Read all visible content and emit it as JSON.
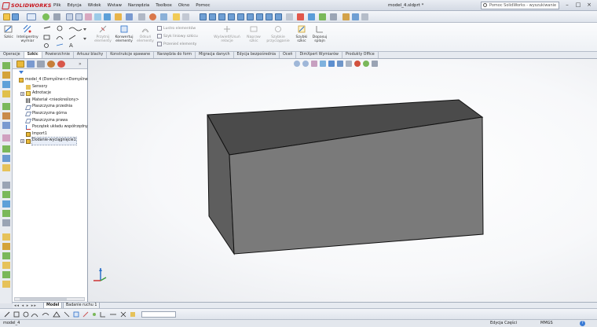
{
  "app": {
    "brand": "SOLIDWORKS",
    "document_title": "model_4.sldprt *",
    "search_placeholder": "Pomoc SolidWorks - wyszukiwanie",
    "menu": [
      "Plik",
      "Edycja",
      "Widok",
      "Wstaw",
      "Narzędzia",
      "Toolbox",
      "Okno",
      "Pomoc"
    ],
    "window_controls": [
      "–",
      "□",
      "×"
    ]
  },
  "ribbon": {
    "sketch": "Szkic",
    "smart_dimension": [
      "Inteligentny",
      "wymiar"
    ],
    "convert": [
      "Przytnij",
      "elementy"
    ],
    "convert_entities": [
      "Konwertuj",
      "elementy"
    ],
    "offset": [
      "Odsuń",
      "elementy"
    ],
    "mirror": "Lustro elementów",
    "linear_pattern": "Szyk liniowy szkicu",
    "move": "Przenieś elementy",
    "display_relations": [
      "Wyświetl/Usuń",
      "relacje"
    ],
    "repair_sketch": [
      "Napraw",
      "szkic"
    ],
    "quick_snaps": [
      "Szybkie",
      "przyciąganie"
    ],
    "rapid_sketch": [
      "Szybki",
      "szkic"
    ],
    "fit_spline": [
      "Dopasuj",
      "splajn"
    ]
  },
  "tabs": [
    "Operacje",
    "Szkic",
    "Powierzchnie",
    "Arkusz blachy",
    "Konstrukcje spawane",
    "Narzędzia do form",
    "Migracja danych",
    "Edycja bezpośrednia",
    "Oceń",
    "DimXpert Wymiarów",
    "Produkty Office"
  ],
  "active_tab": "Szkic",
  "tree": {
    "root": "model_4  (Domyślne<<Domyślne",
    "items": [
      {
        "label": "Sensory",
        "icon": "sensors-icon",
        "expandable": false
      },
      {
        "label": "Adnotacje",
        "icon": "annotations-icon",
        "expandable": true
      },
      {
        "label": "Materiał <nieokreślony>",
        "icon": "material-icon",
        "expandable": false
      },
      {
        "label": "Płaszczyzna przednia",
        "icon": "plane-icon",
        "expandable": false
      },
      {
        "label": "Płaszczyzna górna",
        "icon": "plane-icon",
        "expandable": false
      },
      {
        "label": "Płaszczyzna prawa",
        "icon": "plane-icon",
        "expandable": false
      },
      {
        "label": "Początek układu współrzędnych",
        "icon": "origin-icon",
        "expandable": false
      },
      {
        "label": "Import1",
        "icon": "import-feature-icon",
        "expandable": false
      },
      {
        "label": "Dodanie-wyciągnięcie1",
        "icon": "extrude-feature-icon",
        "expandable": true
      }
    ]
  },
  "bottom_tabs": [
    "Model",
    "Badanie ruchu 1"
  ],
  "active_bottom_tab": "Model",
  "status": {
    "document": "model_4",
    "mode": "Edycja Części",
    "units": "MMGS",
    "help": "?"
  },
  "colors": {
    "box_top": "#4b4b4b",
    "box_front": "#7a7a7a",
    "box_side": "#5e5e5e",
    "brand_red": "#c8161d",
    "accent_blue": "#3a7bd5"
  }
}
